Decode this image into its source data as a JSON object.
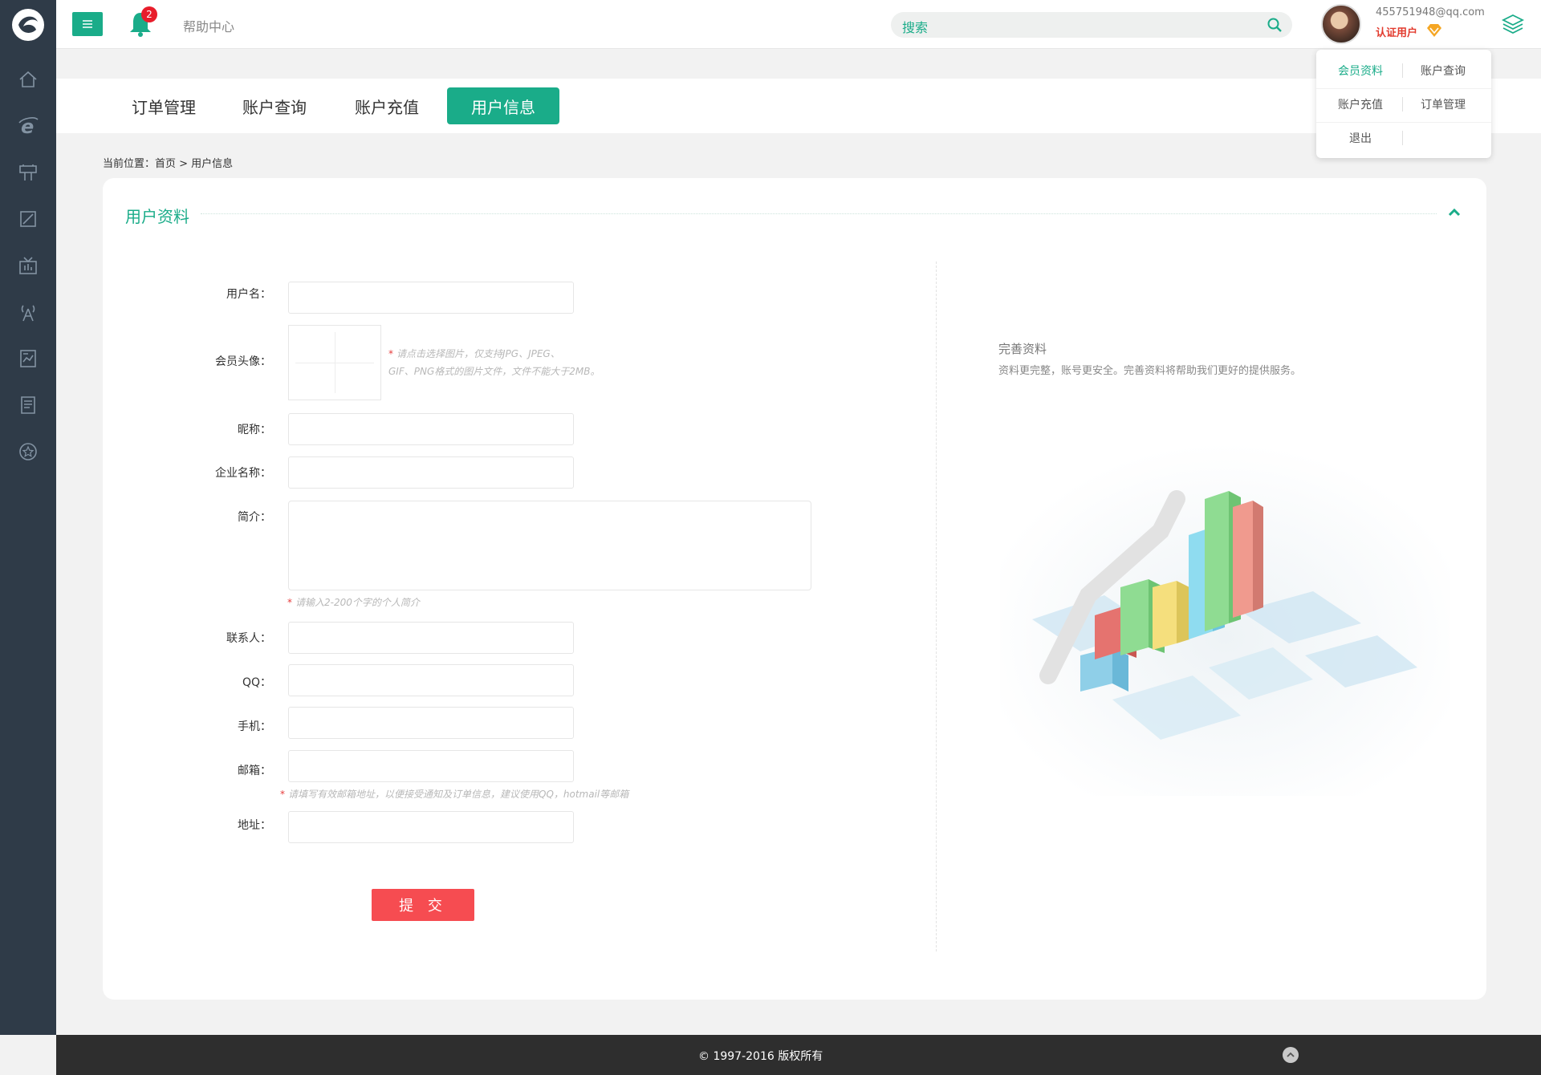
{
  "topbar": {
    "help_label": "帮助中心",
    "notification_count": "2",
    "search_placeholder": "搜索",
    "user_email": "455751948@qq.com",
    "user_role": "认证用户"
  },
  "tabs": [
    {
      "label": "订单管理",
      "active": false
    },
    {
      "label": "账户查询",
      "active": false
    },
    {
      "label": "账户充值",
      "active": false
    },
    {
      "label": "用户信息",
      "active": true
    }
  ],
  "user_menu": {
    "items": [
      "会员资料",
      "账户查询",
      "账户充值",
      "订单管理",
      "退出"
    ],
    "active": "会员资料"
  },
  "sidebar": {
    "icons": [
      "home-icon",
      "browser-icon",
      "signpost-icon",
      "document-edit-icon",
      "tv-icon",
      "antenna-icon",
      "chart-report-icon",
      "notes-icon",
      "star-badge-icon"
    ]
  },
  "breadcrumb": {
    "text": "当前位置：首页 > 用户信息"
  },
  "panel": {
    "title": "用户资料"
  },
  "form": {
    "username_label": "用户名：",
    "avatar_label": "会员头像：",
    "avatar_hint_1": "请点击选择图片，仅支持JPG、JPEG、",
    "avatar_hint_2": "GIF、PNG格式的图片文件，文件不能大于2MB。",
    "nickname_label": "昵称：",
    "company_label": "企业名称：",
    "intro_label": "简介：",
    "intro_hint": "请输入2-200个字的个人简介",
    "contact_label": "联系人：",
    "qq_label": "QQ：",
    "phone_label": "手机：",
    "email_label": "邮箱：",
    "email_hint": "请填写有效邮箱地址，以便接受通知及订单信息，建议使用QQ，hotmail等邮箱",
    "address_label": "地址：",
    "submit_label": "提 交",
    "required_mark": "*"
  },
  "side_info": {
    "title": "完善资料",
    "description": "资料更完整，账号更安全。完善资料将帮助我们更好的提供服务。"
  },
  "footer": {
    "copyright": "© 1997-2016 版权所有"
  },
  "colors": {
    "accent": "#1aac89",
    "sidebar": "#2f3b48",
    "submit": "#f64c51",
    "footer": "#2e2e2e"
  }
}
